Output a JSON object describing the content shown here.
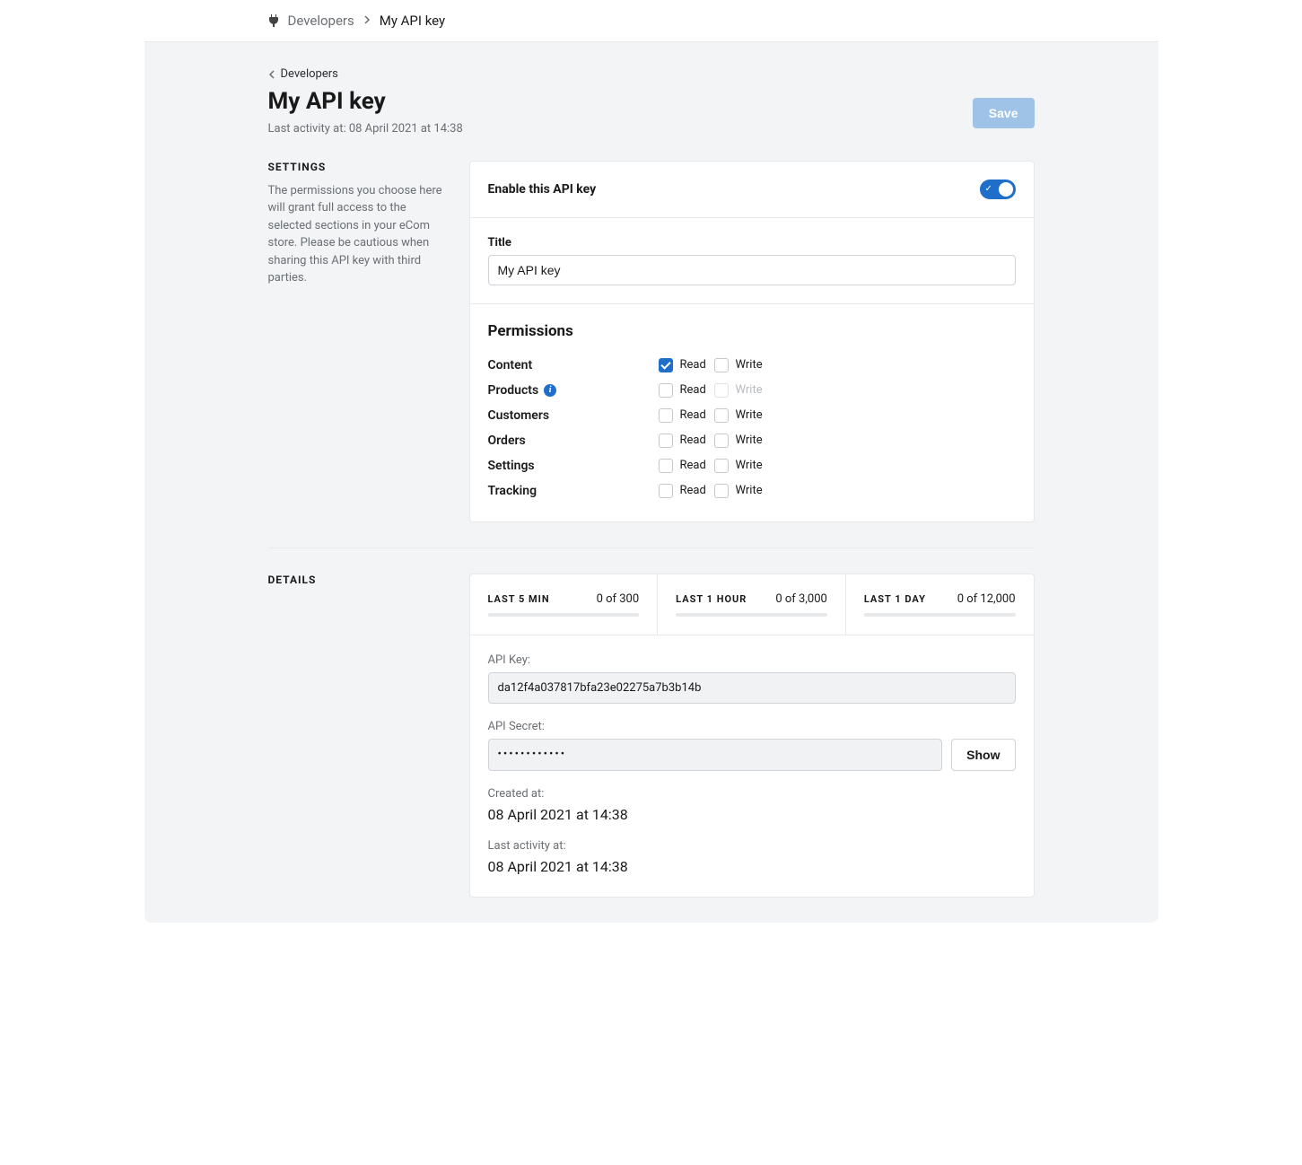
{
  "breadcrumb": {
    "parent": "Developers",
    "current": "My API key"
  },
  "backlink": {
    "label": "Developers"
  },
  "page_title": "My API key",
  "last_activity_prefix": "Last activity at:",
  "last_activity_value": "08 April 2021 at 14:38",
  "save_label": "Save",
  "settings_section": {
    "heading": "SETTINGS",
    "description": "The permissions you choose here will grant full access to the selected sections in your eCom store. Please be cautious when sharing this API key with third parties."
  },
  "enable_label": "Enable this API key",
  "enable_on": true,
  "title_field": {
    "label": "Title",
    "value": "My API key"
  },
  "permissions": {
    "heading": "Permissions",
    "read_label": "Read",
    "write_label": "Write",
    "rows": [
      {
        "name": "Content",
        "info": false,
        "read": true,
        "write": false,
        "write_disabled": false
      },
      {
        "name": "Products",
        "info": true,
        "read": false,
        "write": false,
        "write_disabled": true
      },
      {
        "name": "Customers",
        "info": false,
        "read": false,
        "write": false,
        "write_disabled": false
      },
      {
        "name": "Orders",
        "info": false,
        "read": false,
        "write": false,
        "write_disabled": false
      },
      {
        "name": "Settings",
        "info": false,
        "read": false,
        "write": false,
        "write_disabled": false
      },
      {
        "name": "Tracking",
        "info": false,
        "read": false,
        "write": false,
        "write_disabled": false
      }
    ]
  },
  "details_section": {
    "heading": "DETAILS"
  },
  "stats": [
    {
      "label": "LAST 5 MIN",
      "value": "0 of 300"
    },
    {
      "label": "LAST 1 HOUR",
      "value": "0 of 3,000"
    },
    {
      "label": "LAST 1 DAY",
      "value": "0 of 12,000"
    }
  ],
  "api_key": {
    "label": "API Key:",
    "value": "da12f4a037817bfa23e02275a7b3b14b"
  },
  "api_secret": {
    "label": "API Secret:",
    "value": "••••••••••••",
    "show_label": "Show"
  },
  "created_at": {
    "label": "Created at:",
    "value": "08 April 2021 at 14:38"
  },
  "activity_at": {
    "label": "Last activity at:",
    "value": "08 April 2021 at 14:38"
  }
}
